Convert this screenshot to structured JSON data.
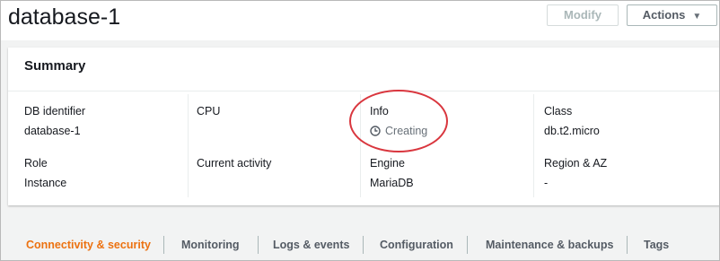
{
  "page": {
    "title": "database-1"
  },
  "header_actions": {
    "modify_label": "Modify",
    "actions_label": "Actions"
  },
  "summary": {
    "title": "Summary",
    "fields": {
      "db_identifier": {
        "label": "DB identifier",
        "value": "database-1"
      },
      "cpu": {
        "label": "CPU",
        "value": ""
      },
      "info": {
        "label": "Info",
        "value": "Creating"
      },
      "class": {
        "label": "Class",
        "value": "db.t2.micro"
      },
      "role": {
        "label": "Role",
        "value": "Instance"
      },
      "current_activity": {
        "label": "Current activity",
        "value": ""
      },
      "engine": {
        "label": "Engine",
        "value": "MariaDB"
      },
      "region_az": {
        "label": "Region & AZ",
        "value": "-"
      }
    }
  },
  "tabs": [
    {
      "label": "Connectivity & security",
      "active": true
    },
    {
      "label": "Monitoring",
      "active": false
    },
    {
      "label": "Logs & events",
      "active": false
    },
    {
      "label": "Configuration",
      "active": false
    },
    {
      "label": "Maintenance & backups",
      "active": false
    },
    {
      "label": "Tags",
      "active": false
    }
  ],
  "colors": {
    "accent_active_tab": "#ec7211",
    "annotation_circle": "#d9363e",
    "status_text": "#687078"
  },
  "icons": {
    "status": "clock-icon",
    "dropdown": "caret-down-icon"
  }
}
